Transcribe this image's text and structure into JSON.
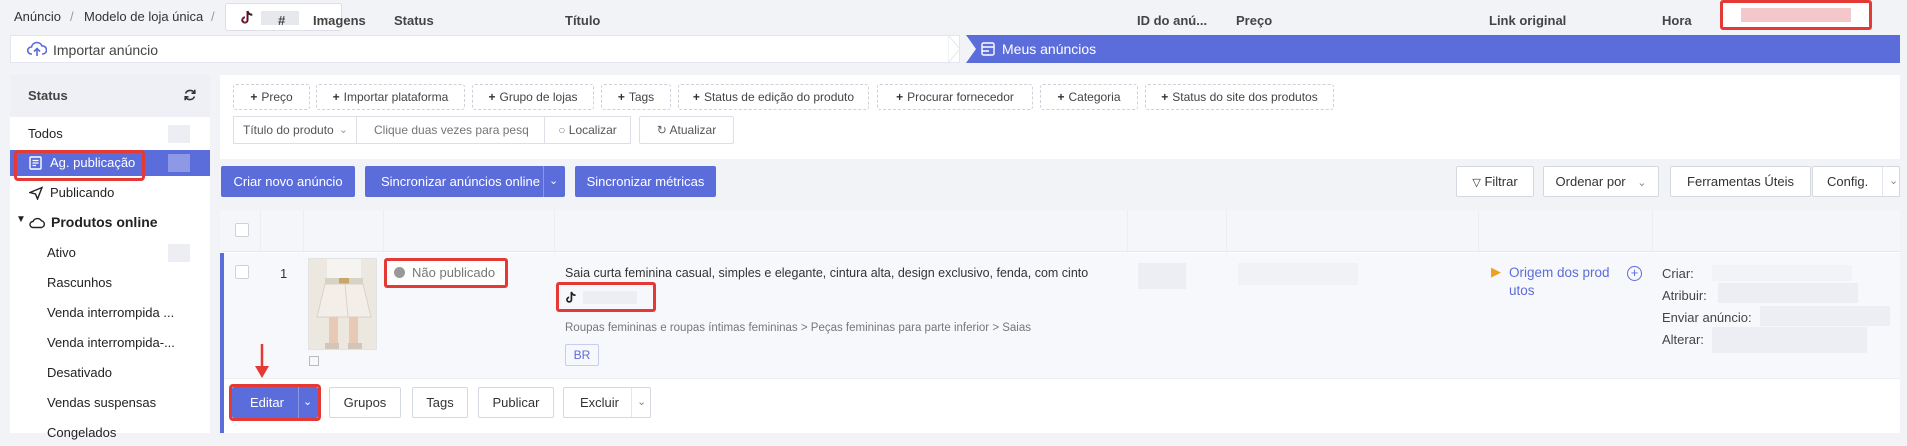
{
  "breadcrumb": {
    "root": "Anúncio",
    "sep": "/",
    "template": "Modelo de loja única"
  },
  "steps": {
    "import": "Importar anúncio",
    "mine": "Meus anúncios"
  },
  "sidebar": {
    "title": "Status",
    "items": [
      {
        "label": "Todos"
      },
      {
        "label": "Ag. publicação"
      },
      {
        "label": "Publicando"
      },
      {
        "label": "Produtos online"
      },
      {
        "label": "Ativo"
      },
      {
        "label": "Rascunhos"
      },
      {
        "label": "Venda interrompida ..."
      },
      {
        "label": "Venda interrompida-..."
      },
      {
        "label": "Desativado"
      },
      {
        "label": "Vendas suspensas"
      },
      {
        "label": "Congelados"
      }
    ]
  },
  "filters": {
    "chips": [
      "Preço",
      "Importar plataforma",
      "Grupo de lojas",
      "Tags",
      "Status de edição do produto",
      "Procurar fornecedor",
      "Categoria",
      "Status do site dos produtos"
    ],
    "field_select": "Título do produto",
    "search_placeholder": "Clique duas vezes para pesq",
    "locate": "Localizar",
    "refresh": "Atualizar"
  },
  "toolbar": {
    "create": "Criar novo anúncio",
    "sync_ads": "Sincronizar anúncios online",
    "sync_metrics": "Sincronizar métricas",
    "filter": "Filtrar",
    "sort": "Ordenar por",
    "tools": "Ferramentas Úteis",
    "config": "Config."
  },
  "table": {
    "headers": {
      "num": "#",
      "images": "Imagens",
      "status": "Status",
      "title": "Título",
      "id": "ID do anú...",
      "price": "Preço",
      "link": "Link original",
      "time": "Hora"
    },
    "row": {
      "index": "1",
      "status": "Não publicado",
      "title": "Saia curta feminina casual, simples e elegante, cintura alta, design exclusivo, fenda, com cinto",
      "category": "Roupas femininas e roupas íntimas femininas > Peças femininas para parte inferior > Saias",
      "site_tag": "BR",
      "link_line1": "Origem dos prod",
      "link_line2": "utos",
      "time_labels": {
        "create": "Criar:",
        "assign": "Atribuir:",
        "send": "Enviar anúncio:",
        "modify": "Alterar:"
      }
    },
    "actions": {
      "edit": "Editar",
      "groups": "Grupos",
      "tags": "Tags",
      "publish": "Publicar",
      "delete": "Excluir"
    }
  },
  "colors": {
    "accent": "#5b6cdb",
    "highlight": "#e53935"
  }
}
